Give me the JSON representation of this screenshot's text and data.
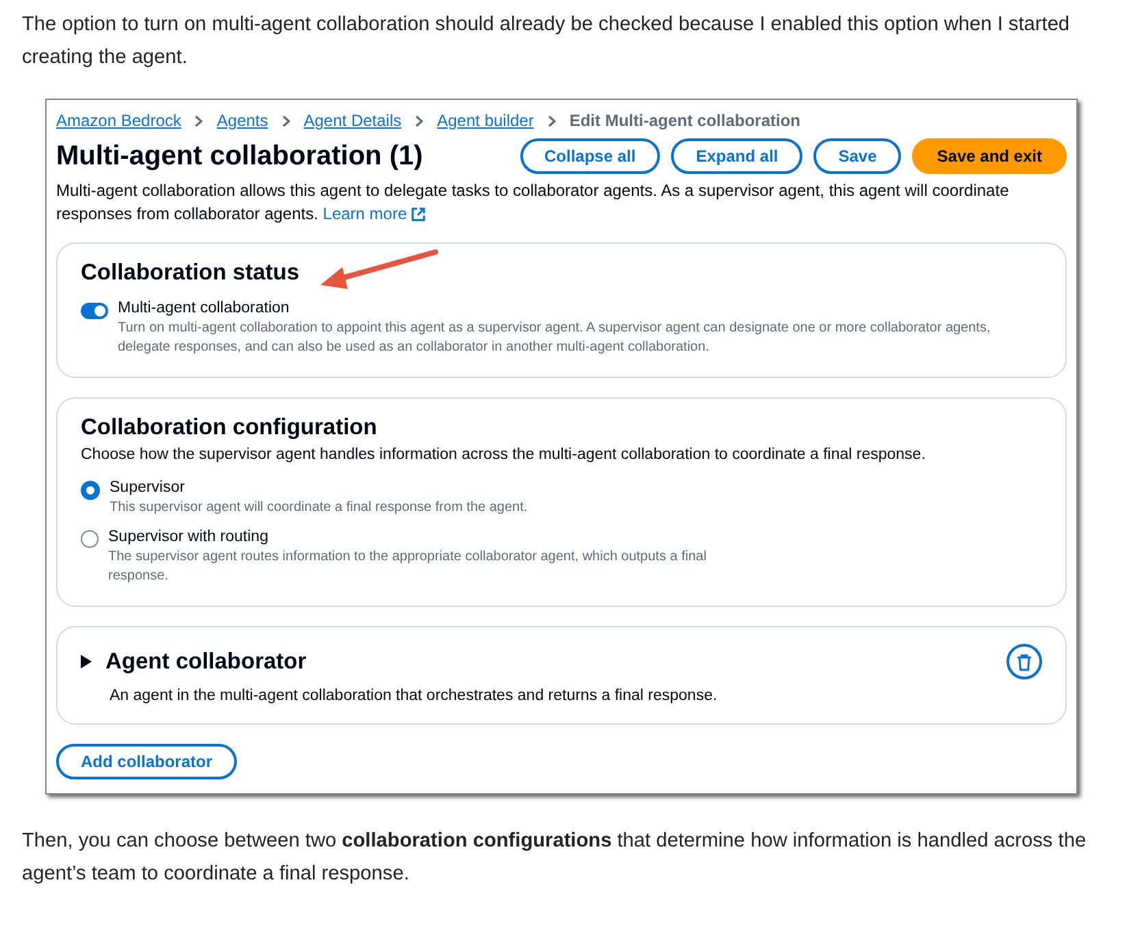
{
  "intro": "The option to turn on multi-agent collaboration should already be checked because I enabled this option when I started creating the agent.",
  "screenshot": {
    "breadcrumbs": [
      {
        "label": "Amazon Bedrock",
        "link": true
      },
      {
        "label": "Agents",
        "link": true
      },
      {
        "label": "Agent Details",
        "link": true
      },
      {
        "label": "Agent builder",
        "link": true
      },
      {
        "label": "Edit Multi-agent collaboration",
        "link": false
      }
    ],
    "title": "Multi-agent collaboration (1)",
    "actions": [
      {
        "label": "Collapse all",
        "primary": false
      },
      {
        "label": "Expand all",
        "primary": false
      },
      {
        "label": "Save",
        "primary": false
      },
      {
        "label": "Save and exit",
        "primary": true
      }
    ],
    "description": "Multi-agent collaboration allows this agent to delegate tasks to collaborator agents. As a supervisor agent, this agent will coordinate responses from collaborator agents.",
    "learn_more": "Learn more",
    "status": {
      "heading": "Collaboration status",
      "toggle": {
        "label": "Multi-agent collaboration",
        "on": true,
        "description": "Turn on multi-agent collaboration to appoint this agent as a supervisor agent. A supervisor agent can designate one or more collaborator agents, delegate responses, and can also be used as an collaborator in another multi-agent collaboration."
      }
    },
    "configuration": {
      "heading": "Collaboration configuration",
      "description": "Choose how the supervisor agent handles information across the multi-agent collaboration to coordinate a final response.",
      "options": [
        {
          "label": "Supervisor",
          "description": "This supervisor agent will coordinate a final response from the agent.",
          "selected": true
        },
        {
          "label": "Supervisor with routing",
          "description": "The supervisor agent routes information to the appropriate collaborator agent, which outputs a final response.",
          "selected": false
        }
      ]
    },
    "collaborator": {
      "heading": "Agent collaborator",
      "expanded": false,
      "description": "An agent in the multi-agent collaboration that orchestrates and returns a final response."
    },
    "add_button": "Add collaborator"
  },
  "outro": "Then, you can choose between two **collaboration configurations** that determine how information is handled across the agent’s team to coordinate a final response."
}
